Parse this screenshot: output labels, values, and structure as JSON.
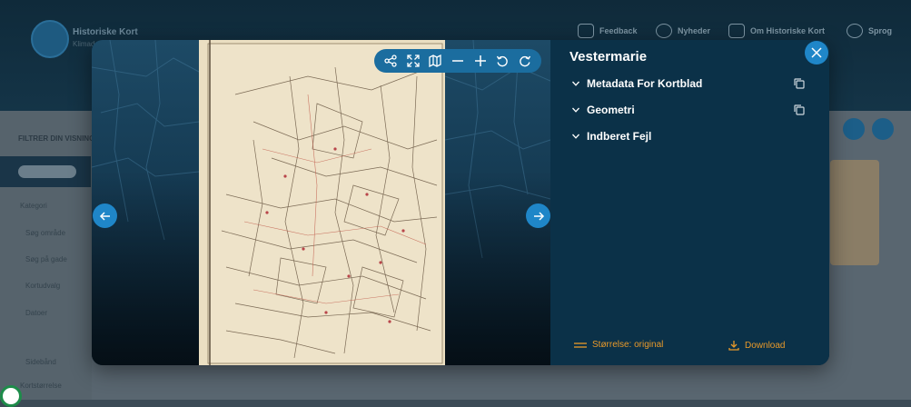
{
  "background": {
    "header": {
      "logo_text": "Historiske Kort",
      "logo_subtext": "Klimadatastyrelsen",
      "nav": [
        {
          "label": "Feedback",
          "icon": "chat-icon"
        },
        {
          "label": "Nyheder",
          "icon": "bell-icon"
        },
        {
          "label": "Om Historiske Kort",
          "icon": "info-icon"
        },
        {
          "label": "Sprog",
          "icon": "globe-icon"
        }
      ]
    },
    "sidebar": {
      "title": "FILTRER DIN VISNING",
      "items": [
        "Kategori",
        "Søg område",
        "Søg på gade",
        "Kortudvalg",
        "Datoer",
        "Sidebånd",
        "Kortstørrelse"
      ]
    }
  },
  "modal": {
    "title": "Vestermarie",
    "sections": [
      {
        "label": "Metadata For Kortblad",
        "copyable": true
      },
      {
        "label": "Geometri",
        "copyable": true
      },
      {
        "label": "Indberet Fejl",
        "copyable": false
      }
    ],
    "footer": {
      "size_label": "Størrelse: original",
      "download_label": "Download"
    },
    "toolbar": [
      "share-icon",
      "fullscreen-icon",
      "map-icon",
      "zoom-out-icon",
      "zoom-in-icon",
      "rotate-left-icon",
      "rotate-right-icon"
    ],
    "colors": {
      "panel_bg": "#0b3148",
      "accent_blue": "#1f86c8",
      "accent_orange": "#e99a2a",
      "map_paper": "#ece0c4"
    }
  }
}
